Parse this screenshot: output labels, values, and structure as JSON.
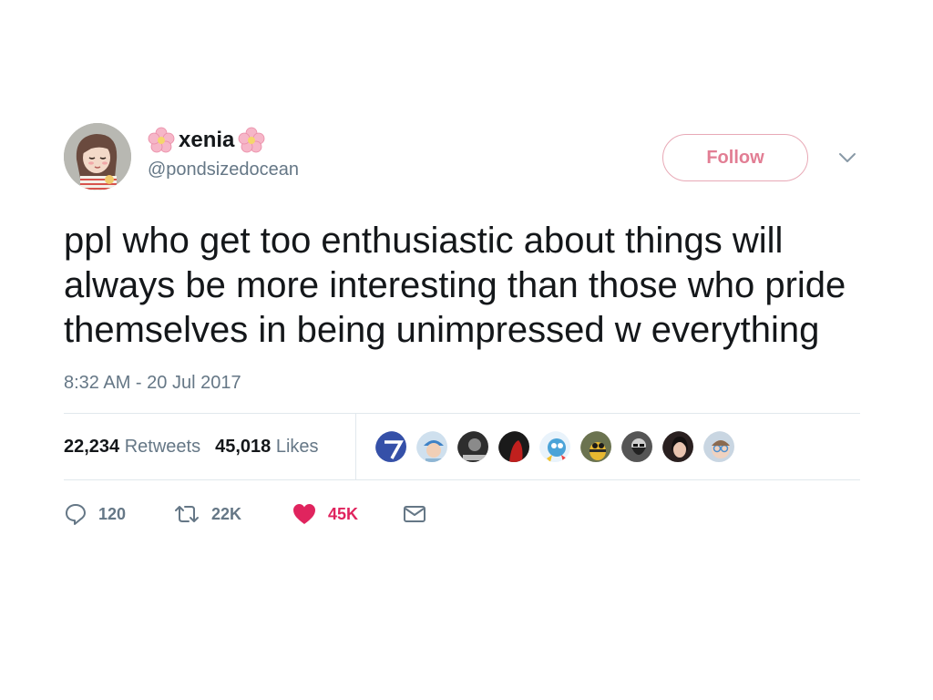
{
  "user": {
    "display_name": "xenia",
    "handle": "@pondsizedocean",
    "follow_label": "Follow"
  },
  "tweet": {
    "text": "ppl who get too enthusiastic about things will always be more interesting than those who pride themselves in being unimpressed w everything",
    "timestamp": "8:32 AM - 20 Jul 2017"
  },
  "stats": {
    "retweets_count": "22,234",
    "retweets_label": "Retweets",
    "likes_count": "45,018",
    "likes_label": "Likes"
  },
  "likers": [
    {
      "icon": "blue-seven-logo",
      "color": "#3550a8"
    },
    {
      "icon": "person-cap",
      "color": "#8fb6d4"
    },
    {
      "icon": "dark-portrait",
      "color": "#3b3b3b"
    },
    {
      "icon": "red-figure",
      "color": "#b21f1f"
    },
    {
      "icon": "cartoon-character",
      "color": "#4aa3d8"
    },
    {
      "icon": "bee-character",
      "color": "#6b7350"
    },
    {
      "icon": "bearded-man",
      "color": "#555555"
    },
    {
      "icon": "dark-haired-woman",
      "color": "#2a2020"
    },
    {
      "icon": "glasses-person",
      "color": "#a0b4c8"
    }
  ],
  "actions": {
    "reply_count": "120",
    "retweet_count": "22K",
    "like_count": "45K"
  },
  "colors": {
    "follow_border": "#e8a9b6",
    "follow_text": "#e27e94",
    "like_red": "#e0245e",
    "muted": "#657786"
  }
}
